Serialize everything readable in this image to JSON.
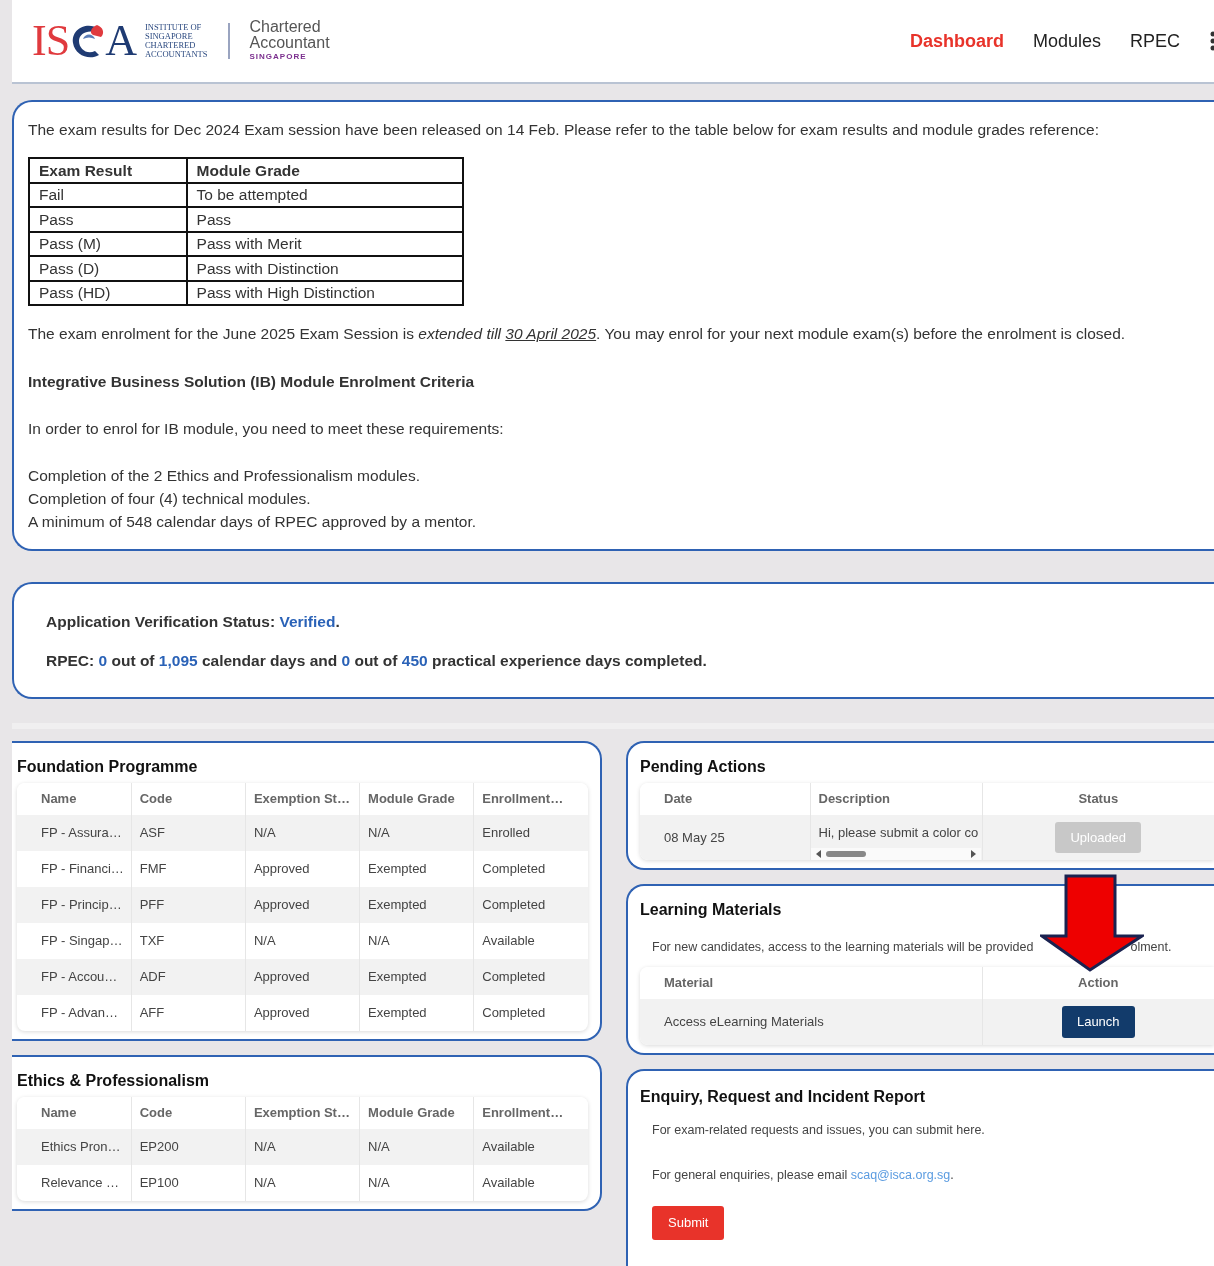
{
  "logo": {
    "left_letters": "IS",
    "right_letter": "A",
    "institute": [
      "INSTITUTE OF",
      "SINGAPORE",
      "CHARTERED",
      "ACCOUNTANTS"
    ],
    "ca_title": [
      "Chartered",
      "Accountant"
    ],
    "ca_sub": "SINGAPORE"
  },
  "nav": [
    {
      "label": "Dashboard",
      "selected": true
    },
    {
      "label": "Modules",
      "selected": false
    },
    {
      "label": "RPEC",
      "selected": false
    }
  ],
  "announcement": {
    "intro": "The exam results for Dec 2024 Exam session have been released on 14 Feb. Please refer to the table below for exam results and module grades reference:",
    "grade_table": {
      "columns": [
        "Exam Result",
        "Module Grade"
      ],
      "rows": [
        [
          "Fail",
          "To be attempted"
        ],
        [
          "Pass",
          "Pass"
        ],
        [
          "Pass (M)",
          "Pass with Merit"
        ],
        [
          "Pass (D)",
          "Pass with Distinction"
        ],
        [
          "Pass (HD)",
          "Pass with High Distinction"
        ]
      ]
    },
    "enrolment_notice": [
      {
        "text": "The exam enrolment for the June 2025 Exam Session is ",
        "kind": "plain"
      },
      {
        "text": "extended till ",
        "kind": "emphasis"
      },
      {
        "text": "30 April 2025",
        "kind": "deadline"
      },
      {
        "text": ". You may enrol for your next module exam(s) before the enrolment is closed.",
        "kind": "plain"
      }
    ],
    "criteria_title": "Integrative Business Solution (IB) Module Enrolment Criteria",
    "criteria_intro": "In order to enrol for IB module, you need to meet these requirements:",
    "requirements": [
      "Completion of the 2 Ethics and Professionalism modules.",
      "Completion of four (4) technical modules.",
      "A minimum of 548 calendar days of RPEC approved by a mentor."
    ]
  },
  "status": {
    "verification": [
      {
        "text": "Application Verification Status: ",
        "kind": "plain"
      },
      {
        "text": "Verified",
        "kind": "value"
      },
      {
        "text": ".",
        "kind": "plain"
      }
    ],
    "rpec": [
      {
        "text": "RPEC: ",
        "kind": "plain"
      },
      {
        "text": "0",
        "kind": "value"
      },
      {
        "text": " out of ",
        "kind": "plain"
      },
      {
        "text": "1,095",
        "kind": "value"
      },
      {
        "text": " calendar days and ",
        "kind": "plain"
      },
      {
        "text": "0",
        "kind": "value"
      },
      {
        "text": " out of ",
        "kind": "plain"
      },
      {
        "text": "450",
        "kind": "value"
      },
      {
        "text": " practical experience days completed.",
        "kind": "plain"
      }
    ]
  },
  "foundation": {
    "title": "Foundation Programme",
    "columns": [
      "Name",
      "Code",
      "Exemption St…",
      "Module Grade",
      "Enrollment…"
    ],
    "rows": [
      [
        "FP - Assura…",
        "ASF",
        "N/A",
        "N/A",
        "Enrolled"
      ],
      [
        "FP - Financi…",
        "FMF",
        "Approved",
        "Exempted",
        "Completed"
      ],
      [
        "FP - Princip…",
        "PFF",
        "Approved",
        "Exempted",
        "Completed"
      ],
      [
        "FP - Singap…",
        "TXF",
        "N/A",
        "N/A",
        "Available"
      ],
      [
        "FP - Accou…",
        "ADF",
        "Approved",
        "Exempted",
        "Completed"
      ],
      [
        "FP - Advan…",
        "AFF",
        "Approved",
        "Exempted",
        "Completed"
      ]
    ]
  },
  "ethics": {
    "title": "Ethics & Professionalism",
    "columns": [
      "Name",
      "Code",
      "Exemption St…",
      "Module Grade",
      "Enrollment…"
    ],
    "rows": [
      [
        "Ethics Pron…",
        "EP200",
        "N/A",
        "N/A",
        "Available"
      ],
      [
        "Relevance …",
        "EP100",
        "N/A",
        "N/A",
        "Available"
      ]
    ]
  },
  "pending": {
    "title": "Pending Actions",
    "columns": [
      "Date",
      "Description",
      "Status"
    ],
    "rows": [
      {
        "date": "08 May 25",
        "description": "Hi, please submit a color co",
        "status": "Uploaded",
        "disabled": true
      }
    ]
  },
  "learning": {
    "title": "Learning Materials",
    "note_start": "For new candidates, access to the learning materials will be provided",
    "note_end": "olment.",
    "columns": [
      "Material",
      "Action"
    ],
    "rows": [
      {
        "material": "Access eLearning Materials",
        "action": "Launch"
      }
    ]
  },
  "enquiry": {
    "title": "Enquiry, Request and Incident Report",
    "line1": "For exam-related requests and issues, you can submit here.",
    "line2": [
      {
        "text": "For general enquiries, please email ",
        "kind": "plain"
      },
      {
        "text": "scaq@isca.org.sg",
        "kind": "link"
      },
      {
        "text": ".",
        "kind": "plain"
      }
    ],
    "submit": "Submit"
  }
}
